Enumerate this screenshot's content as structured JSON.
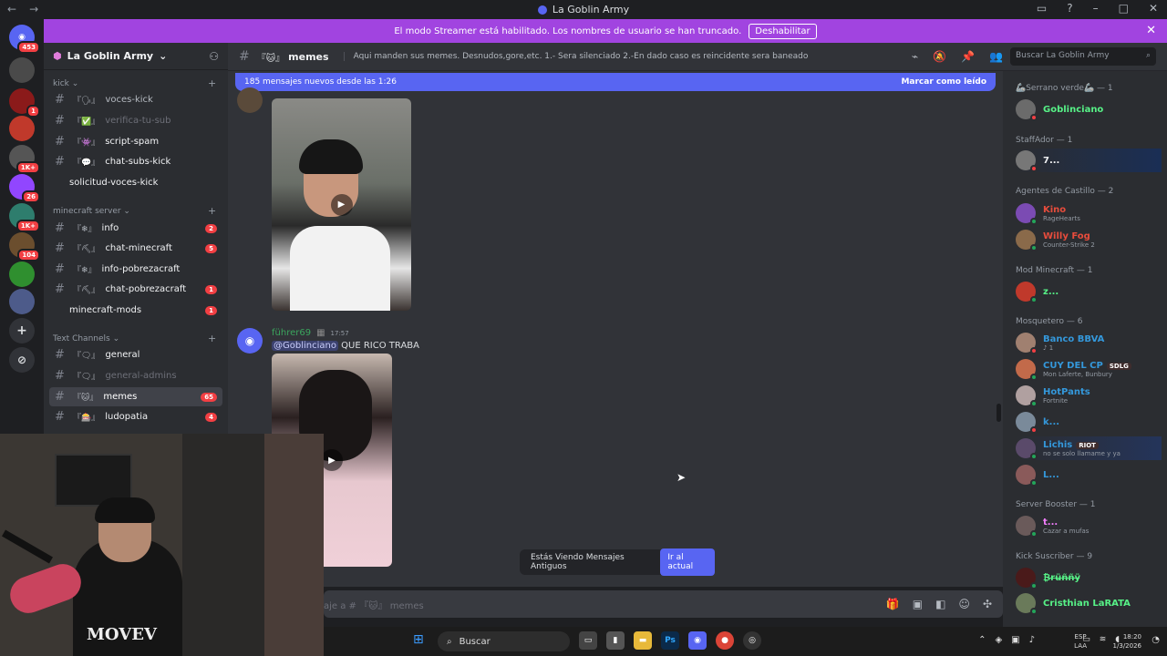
{
  "window": {
    "title": "La Goblin Army"
  },
  "banner": {
    "text": "El modo Streamer está habilitado. Los nombres de usuario se han truncado.",
    "button": "Deshabilitar"
  },
  "guilds": [
    {
      "badge": "453"
    },
    {
      "badge": ""
    },
    {
      "badge": "1"
    },
    {
      "badge": ""
    },
    {
      "badge": "1K+"
    },
    {
      "badge": "26"
    },
    {
      "badge": "1K+"
    },
    {
      "badge": "104"
    },
    {
      "badge": ""
    },
    {
      "badge": ""
    }
  ],
  "server": {
    "name": "La Goblin Army"
  },
  "categories": {
    "kick": "kick",
    "minecraft": "minecraft server",
    "text": "Text Channels"
  },
  "channels": [
    {
      "emoji": "『🗣』",
      "name": "voces-kick",
      "count": ""
    },
    {
      "emoji": "『✅』",
      "name": "verifica-tu-sub",
      "count": ""
    },
    {
      "emoji": "『👾』",
      "name": "script-spam",
      "count": ""
    },
    {
      "emoji": "『💬』",
      "name": "chat-subs-kick",
      "count": ""
    },
    {
      "emoji": "",
      "name": "solicitud-voces-kick",
      "count": ""
    },
    {
      "emoji": "『❄』",
      "name": "info",
      "count": "2"
    },
    {
      "emoji": "『⛏』",
      "name": "chat-minecraft",
      "count": "5"
    },
    {
      "emoji": "『❄』",
      "name": "info-pobrezacraft",
      "count": ""
    },
    {
      "emoji": "『⛏』",
      "name": "chat-pobrezacraft",
      "count": "1"
    },
    {
      "emoji": "",
      "name": "minecraft-mods",
      "count": "1"
    },
    {
      "emoji": "『🗨』",
      "name": "general",
      "count": ""
    },
    {
      "emoji": "『🗨』",
      "name": "general-admins",
      "count": ""
    },
    {
      "emoji": "『🐱』",
      "name": "memes",
      "count": "65"
    },
    {
      "emoji": "『🎰』",
      "name": "ludopatia",
      "count": "4"
    }
  ],
  "chat": {
    "channel_emoji": "『🐱』",
    "channel_name": "memes",
    "topic": "Aqui manden sus memes. Desnudos,gore,etc. 1.- Sera silenciado 2.-En dado caso es reincidente sera baneado",
    "search_placeholder": "Buscar La Goblin Army",
    "new_messages": "185 mensajes nuevos desde las 1:26",
    "mark_read": "Marcar como leído",
    "message": {
      "author": "führer69",
      "time": "17:57",
      "mention": "@Goblinciano",
      "text": "QUE RICO TRABA"
    },
    "old_notice": "Estás Viendo Mensajes Antiguos",
    "go_current": "Ir al actual",
    "composer_placeholder": "aje a # 『🐱』 memes"
  },
  "members": {
    "roles": [
      {
        "name": "🦾Serrano verde🦾 — 1"
      },
      {
        "name": "StaffAdor — 1"
      },
      {
        "name": "Agentes de Castillo — 2"
      },
      {
        "name": "Mod Minecraft — 1"
      },
      {
        "name": "Mosquetero — 6"
      },
      {
        "name": "Server Booster — 1"
      },
      {
        "name": "Kick Suscriber — 9"
      }
    ],
    "list": [
      {
        "name": "Goblinciano",
        "sub": "",
        "color": "#57f287"
      },
      {
        "name": "7...",
        "sub": "",
        "color": "#f2f3f5"
      },
      {
        "name": "Kino",
        "sub": "RageHearts",
        "color": "#e74c3c"
      },
      {
        "name": "Willy Fog",
        "sub": "Counter-Strike 2",
        "color": "#e74c3c"
      },
      {
        "name": "z...",
        "sub": "",
        "color": "#57f287"
      },
      {
        "name": "Banco BBVA",
        "sub": "♪ 1",
        "color": "#3498db"
      },
      {
        "name": "CUY DEL CP",
        "sub": "Mon Laferte, Bunbury",
        "color": "#3498db",
        "tag": "SDLG"
      },
      {
        "name": "HotPants",
        "sub": "Fortnite",
        "color": "#3498db"
      },
      {
        "name": "k...",
        "sub": "",
        "color": "#3498db"
      },
      {
        "name": "Lichis",
        "sub": "no se solo llamame y ya",
        "color": "#3498db",
        "tag": "RIOT"
      },
      {
        "name": "L...",
        "sub": "",
        "color": "#3498db"
      },
      {
        "name": "t...",
        "sub": "Cazar a mufas",
        "color": "#f47fff"
      },
      {
        "name": "₿r̶ü̶ñ̶ñ̶ÿ̶",
        "sub": "",
        "color": "#57f287"
      },
      {
        "name": "Cristhian LaRATA",
        "sub": "",
        "color": "#57f287"
      }
    ]
  },
  "webcam": {
    "shirt_text": "MOVEV"
  },
  "taskbar": {
    "search": "Buscar",
    "lang1": "ESP",
    "lang2": "LAA",
    "time": "18:20",
    "date": "1/3/2026"
  }
}
